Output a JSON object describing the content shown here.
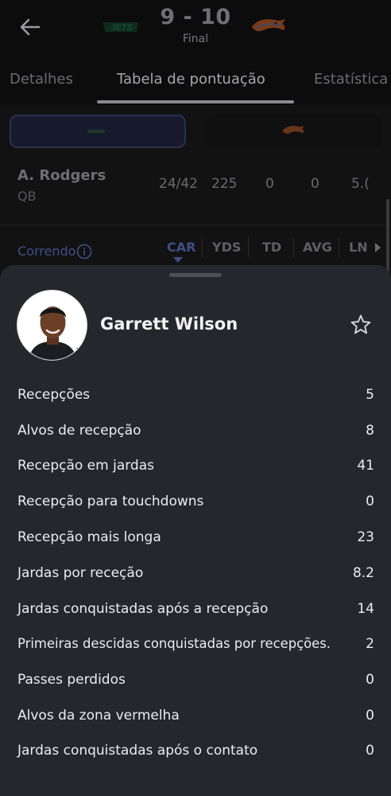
{
  "header": {
    "score": "9 - 10",
    "status": "Final",
    "home_team_logo": "jets-logo",
    "away_team_logo": "broncos-logo"
  },
  "tabs": [
    {
      "label": "Detalhes"
    },
    {
      "label": "Tabela de pontuação"
    },
    {
      "label": "Estatística"
    }
  ],
  "passing_row": {
    "name": "A. Rodgers",
    "position": "QB",
    "stats": [
      "24/42",
      "225",
      "0",
      "0",
      "5.("
    ]
  },
  "rushing": {
    "label": "Correndo",
    "columns": [
      "CAR",
      "YDS",
      "TD",
      "AVG",
      "LN"
    ]
  },
  "sheet": {
    "player_name": "Garrett Wilson",
    "stats": [
      {
        "label": "Recepções",
        "value": "5"
      },
      {
        "label": "Alvos de recepção",
        "value": "8"
      },
      {
        "label": "Recepção em jardas",
        "value": "41"
      },
      {
        "label": "Recepção para touchdowns",
        "value": "0"
      },
      {
        "label": "Recepção mais longa",
        "value": "23"
      },
      {
        "label": "Jardas por receção",
        "value": "8.2"
      },
      {
        "label": "Jardas conquistadas após a recepção",
        "value": "14"
      },
      {
        "label": "Primeiras descidas conquistadas por recepções.",
        "value": "2"
      },
      {
        "label": "Passes perdidos",
        "value": "0"
      },
      {
        "label": "Alvos da zona vermelha",
        "value": "0"
      },
      {
        "label": "Jardas conquistadas após o contato",
        "value": "0"
      }
    ]
  },
  "colors": {
    "sheet_bg": "#26272c",
    "accent_blue": "#3e4f86",
    "jets_green": "#125740",
    "broncos_orange": "#fb4f14"
  }
}
